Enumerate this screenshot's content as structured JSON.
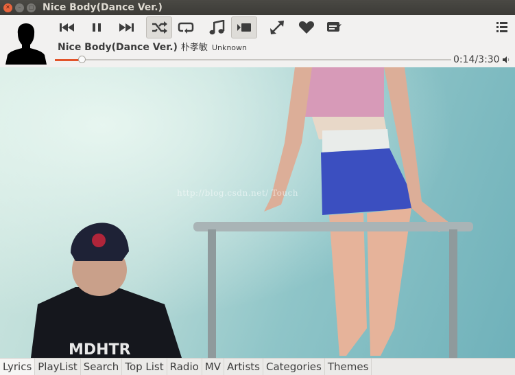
{
  "window": {
    "title": "Nice Body(Dance Ver.)",
    "buttons": [
      "close",
      "minimize",
      "maximize"
    ]
  },
  "controls": [
    {
      "name": "previous",
      "icon": "skip-previous-icon",
      "active": false
    },
    {
      "name": "pause",
      "icon": "pause-icon",
      "active": false
    },
    {
      "name": "next",
      "icon": "skip-next-icon",
      "active": false
    },
    {
      "name": "shuffle",
      "icon": "shuffle-icon",
      "active": true
    },
    {
      "name": "repeat",
      "icon": "repeat-icon",
      "active": false
    },
    {
      "name": "music",
      "icon": "music-note-icon",
      "active": false
    },
    {
      "name": "video",
      "icon": "video-icon",
      "active": true
    },
    {
      "name": "fullscreen",
      "icon": "fullscreen-icon",
      "active": false
    },
    {
      "name": "favorite",
      "icon": "heart-icon",
      "active": false
    },
    {
      "name": "comment",
      "icon": "comment-icon",
      "active": false
    }
  ],
  "now_playing": {
    "title": "Nice Body(Dance Ver.)",
    "artist": "朴孝敏",
    "album": "Unknown",
    "time": "0:14/3:30",
    "progress_fraction": 0.0667
  },
  "video": {
    "watermark": "http://blog.csdn.net/      Touch"
  },
  "tabs": [
    {
      "label": "Lyrics",
      "selected": true
    },
    {
      "label": "PlayList",
      "selected": false
    },
    {
      "label": "Search",
      "selected": false
    },
    {
      "label": "Top List",
      "selected": false
    },
    {
      "label": "Radio",
      "selected": false
    },
    {
      "label": "MV",
      "selected": false
    },
    {
      "label": "Artists",
      "selected": false
    },
    {
      "label": "Categories",
      "selected": false
    },
    {
      "label": "Themes",
      "selected": false
    }
  ],
  "colors": {
    "accent": "#e2542a",
    "icon": "#3c3c3c",
    "titlebar": "#3c3b37"
  }
}
